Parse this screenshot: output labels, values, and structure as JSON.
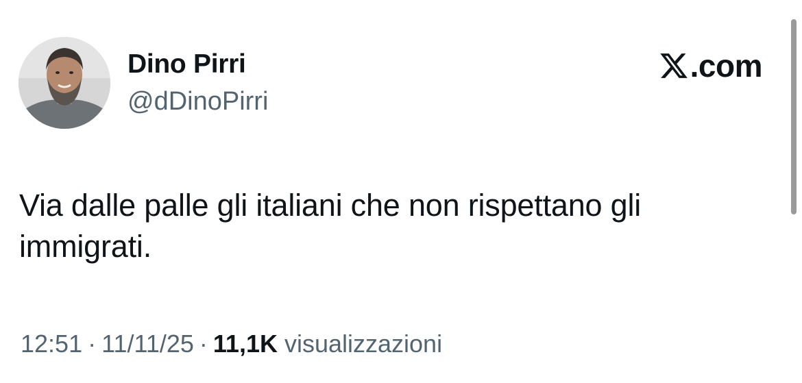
{
  "author": {
    "name": "Dino Pirri",
    "handle": "@dDinoPirri"
  },
  "brand": {
    "text": ".com",
    "icon": "x-logo-icon"
  },
  "tweet": {
    "text": "Via dalle palle gli italiani che non rispettano gli immigrati."
  },
  "meta": {
    "time": "12:51",
    "separator": "·",
    "date": "11/11/25",
    "views_count": "11,1K",
    "views_label": "visualizzazioni"
  },
  "colors": {
    "text": "#0f1419",
    "secondary": "#536471",
    "background": "#ffffff"
  }
}
